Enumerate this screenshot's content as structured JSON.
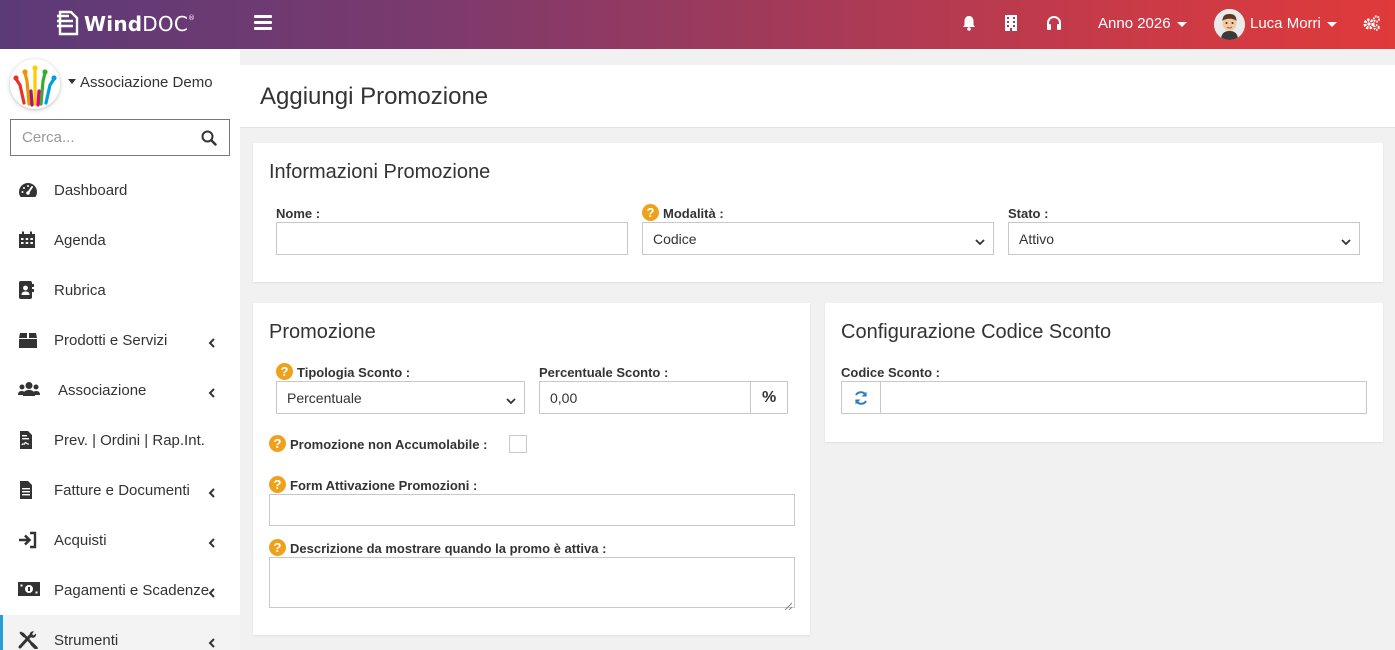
{
  "app": {
    "brand_main": "Wind",
    "brand_accent": "DOC",
    "brand_mark": "®",
    "year_label": "Anno 2026",
    "user_name": "Luca Morri",
    "colors": {
      "topbar_start": "#5b3a78",
      "topbar_end": "#e03a3a",
      "help": "#f0a11c",
      "accent": "#2a9fd6"
    }
  },
  "topbar": {
    "icons": [
      "bell-icon",
      "building-icon",
      "headset-icon",
      "cogs-icon"
    ]
  },
  "sidebar": {
    "org_name": "Associazione Demo",
    "search_placeholder": "Cerca...",
    "items": [
      {
        "label": "Dashboard",
        "icon": "dashboard-icon",
        "has_children": false
      },
      {
        "label": "Agenda",
        "icon": "calendar-icon",
        "has_children": false
      },
      {
        "label": "Rubrica",
        "icon": "address-book-icon",
        "has_children": false
      },
      {
        "label": "Prodotti e Servizi",
        "icon": "box-icon",
        "has_children": true
      },
      {
        "label": "Associazione",
        "icon": "users-icon",
        "has_children": true
      },
      {
        "label": "Prev. | Ordini | Rap.Int.",
        "icon": "file-contract-icon",
        "has_children": false
      },
      {
        "label": "Fatture e Documenti",
        "icon": "file-icon",
        "has_children": true
      },
      {
        "label": "Acquisti",
        "icon": "sign-in-icon",
        "has_children": true
      },
      {
        "label": "Pagamenti e Scadenze",
        "icon": "money-icon",
        "has_children": true
      },
      {
        "label": "Strumenti",
        "icon": "tools-icon",
        "has_children": true,
        "active": true
      }
    ]
  },
  "page": {
    "title": "Aggiungi Promozione"
  },
  "info_panel": {
    "title": "Informazioni Promozione",
    "nome_label": "Nome :",
    "nome_value": "",
    "modalita_label": "Modalità :",
    "modalita_value": "Codice",
    "stato_label": "Stato :",
    "stato_value": "Attivo"
  },
  "promo_panel": {
    "title": "Promozione",
    "tipologia_label": "Tipologia Sconto :",
    "tipologia_value": "Percentuale",
    "percentuale_label": "Percentuale Sconto :",
    "percentuale_value": "0,00",
    "percent_symbol": "%",
    "non_accumulabile_label": "Promozione non Accumolabile :",
    "non_accumulabile_checked": false,
    "form_label": "Form Attivazione Promozioni :",
    "form_value": "",
    "descrizione_label": "Descrizione da mostrare quando la promo è attiva :",
    "descrizione_value": ""
  },
  "code_panel": {
    "title": "Configurazione Codice Sconto",
    "codice_label": "Codice Sconto :",
    "codice_value": ""
  }
}
